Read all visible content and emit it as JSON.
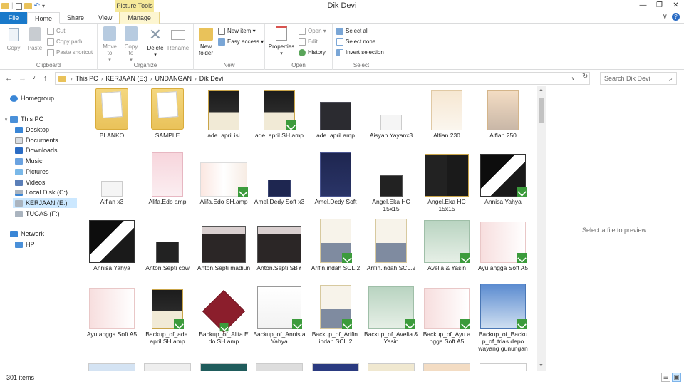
{
  "window": {
    "title": "Dik Devi",
    "context_tab": "Picture Tools",
    "min_icon": "minimize-icon",
    "max_icon": "maximize-icon",
    "close_icon": "close-icon"
  },
  "tabs": [
    {
      "label": "File"
    },
    {
      "label": "Home"
    },
    {
      "label": "Share"
    },
    {
      "label": "View"
    },
    {
      "label": "Manage"
    }
  ],
  "ribbon": {
    "clipboard": {
      "label": "Clipboard",
      "copy": "Copy",
      "paste": "Paste",
      "cut": "Cut",
      "copy_path": "Copy path",
      "paste_shortcut": "Paste shortcut"
    },
    "organize": {
      "label": "Organize",
      "move_to": "Move to",
      "copy_to": "Copy to",
      "delete": "Delete",
      "rename": "Rename"
    },
    "new": {
      "label": "New",
      "new_folder": "New folder",
      "new_item": "New item",
      "easy_access": "Easy access"
    },
    "open": {
      "label": "Open",
      "properties": "Properties",
      "open": "Open",
      "edit": "Edit",
      "history": "History"
    },
    "select": {
      "label": "Select",
      "select_all": "Select all",
      "select_none": "Select none",
      "invert_selection": "Invert selection"
    }
  },
  "address": {
    "crumbs": [
      "This PC",
      "KERJAAN (E:)",
      "UNDANGAN",
      "Dik Devi"
    ],
    "search_placeholder": "Search Dik Devi"
  },
  "nav": {
    "homegroup": "Homegroup",
    "this_pc": "This PC",
    "items": [
      "Desktop",
      "Documents",
      "Downloads",
      "Music",
      "Pictures",
      "Videos",
      "Local Disk (C:)",
      "KERJAAN (E:)",
      "TUGAS (F:)"
    ],
    "network": "Network",
    "network_items": [
      "HP"
    ]
  },
  "files": [
    {
      "name": "BLANKO",
      "kind": "folder"
    },
    {
      "name": "SAMPLE",
      "kind": "folder"
    },
    {
      "name": "ade. april  isi",
      "kind": "image",
      "style": "dark-gold"
    },
    {
      "name": "ade. april SH.amp",
      "kind": "image",
      "style": "dark-gold",
      "check": true
    },
    {
      "name": "ade. april amp",
      "kind": "image",
      "style": "dark"
    },
    {
      "name": "Aisyah.Yayanx3",
      "kind": "image",
      "style": "light-small"
    },
    {
      "name": "Alfian 230",
      "kind": "image",
      "style": "floral"
    },
    {
      "name": "Alfian 250",
      "kind": "image",
      "style": "floral-photo"
    },
    {
      "name": "Alfian x3",
      "kind": "image",
      "style": "light-small"
    },
    {
      "name": "Alifa.Edo amp",
      "kind": "image",
      "style": "pink"
    },
    {
      "name": "Alifa.Edo SH.amp",
      "kind": "image",
      "style": "floral-wide",
      "check": true
    },
    {
      "name": "Amel.Dedy Soft x3",
      "kind": "image",
      "style": "navy-small"
    },
    {
      "name": "Amel.Dedy Soft",
      "kind": "image",
      "style": "navy"
    },
    {
      "name": "Angel.Eka HC 15x15",
      "kind": "image",
      "style": "dark-small"
    },
    {
      "name": "Angel.Eka HC 15x15",
      "kind": "image",
      "style": "dark-gold-wide"
    },
    {
      "name": "Annisa Yahya",
      "kind": "image",
      "style": "black-wide",
      "check": true
    },
    {
      "name": "Annisa Yahya",
      "kind": "image",
      "style": "black-wide"
    },
    {
      "name": "Anton.Septi cow",
      "kind": "image",
      "style": "dark-small"
    },
    {
      "name": "Anton.Septi madiun",
      "kind": "image",
      "style": "dark-wide"
    },
    {
      "name": "Anton.Septi SBY",
      "kind": "image",
      "style": "dark-wide"
    },
    {
      "name": "Arifin.indah SCL.2",
      "kind": "image",
      "style": "photo",
      "check": true
    },
    {
      "name": "Arifin.indah SCL.2",
      "kind": "image",
      "style": "photo"
    },
    {
      "name": "Avelia & Yasin",
      "kind": "image",
      "style": "sage",
      "check": true
    },
    {
      "name": "Ayu.angga Soft A5",
      "kind": "image",
      "style": "pink-wide",
      "check": true
    },
    {
      "name": "Ayu.angga Soft A5",
      "kind": "image",
      "style": "pink-wide"
    },
    {
      "name": "Backup_of_ade. april  SH.amp",
      "kind": "image",
      "style": "dark-gold",
      "check": true
    },
    {
      "name": "Backup_of_Alifa.E do SH.amp",
      "kind": "image",
      "style": "maroon",
      "check": true
    },
    {
      "name": "Backup_of_Annis a Yahya",
      "kind": "image",
      "style": "envelope",
      "check": true
    },
    {
      "name": "Backup_of_Arifin. indah SCL.2",
      "kind": "image",
      "style": "photo",
      "check": true
    },
    {
      "name": "Backup_of_Avelia & Yasin",
      "kind": "image",
      "style": "sage",
      "check": true
    },
    {
      "name": "Backup_of_Ayu.a ngga Soft A5",
      "kind": "image",
      "style": "pink-wide",
      "check": true
    },
    {
      "name": "Backup_of_Backu p_of_trias depo wayang gunungan",
      "kind": "image",
      "style": "wayang",
      "check": true
    }
  ],
  "preview": {
    "text": "Select a file to preview."
  },
  "status": {
    "count": "301 items"
  },
  "colors": {
    "accent": "#1979ca",
    "selected": "#cce8ff",
    "folder": "#e9c25a",
    "check": "#3c9b3c",
    "manage": "#f6e99a"
  }
}
